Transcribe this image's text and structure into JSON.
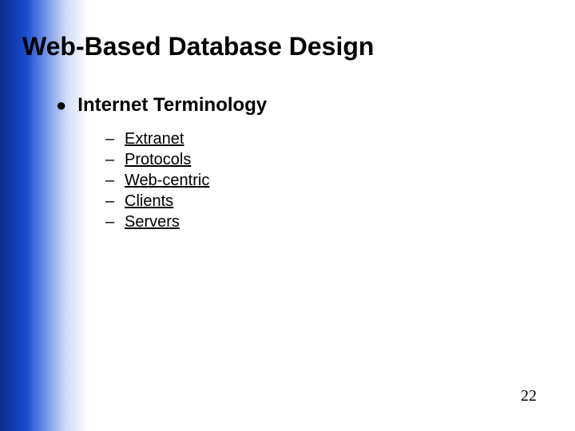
{
  "title": "Web-Based Database Design",
  "main_bullet": "Internet Terminology",
  "sub_items": [
    "Extranet",
    "Protocols",
    "Web-centric",
    "Clients",
    "Servers"
  ],
  "page_number": "22"
}
